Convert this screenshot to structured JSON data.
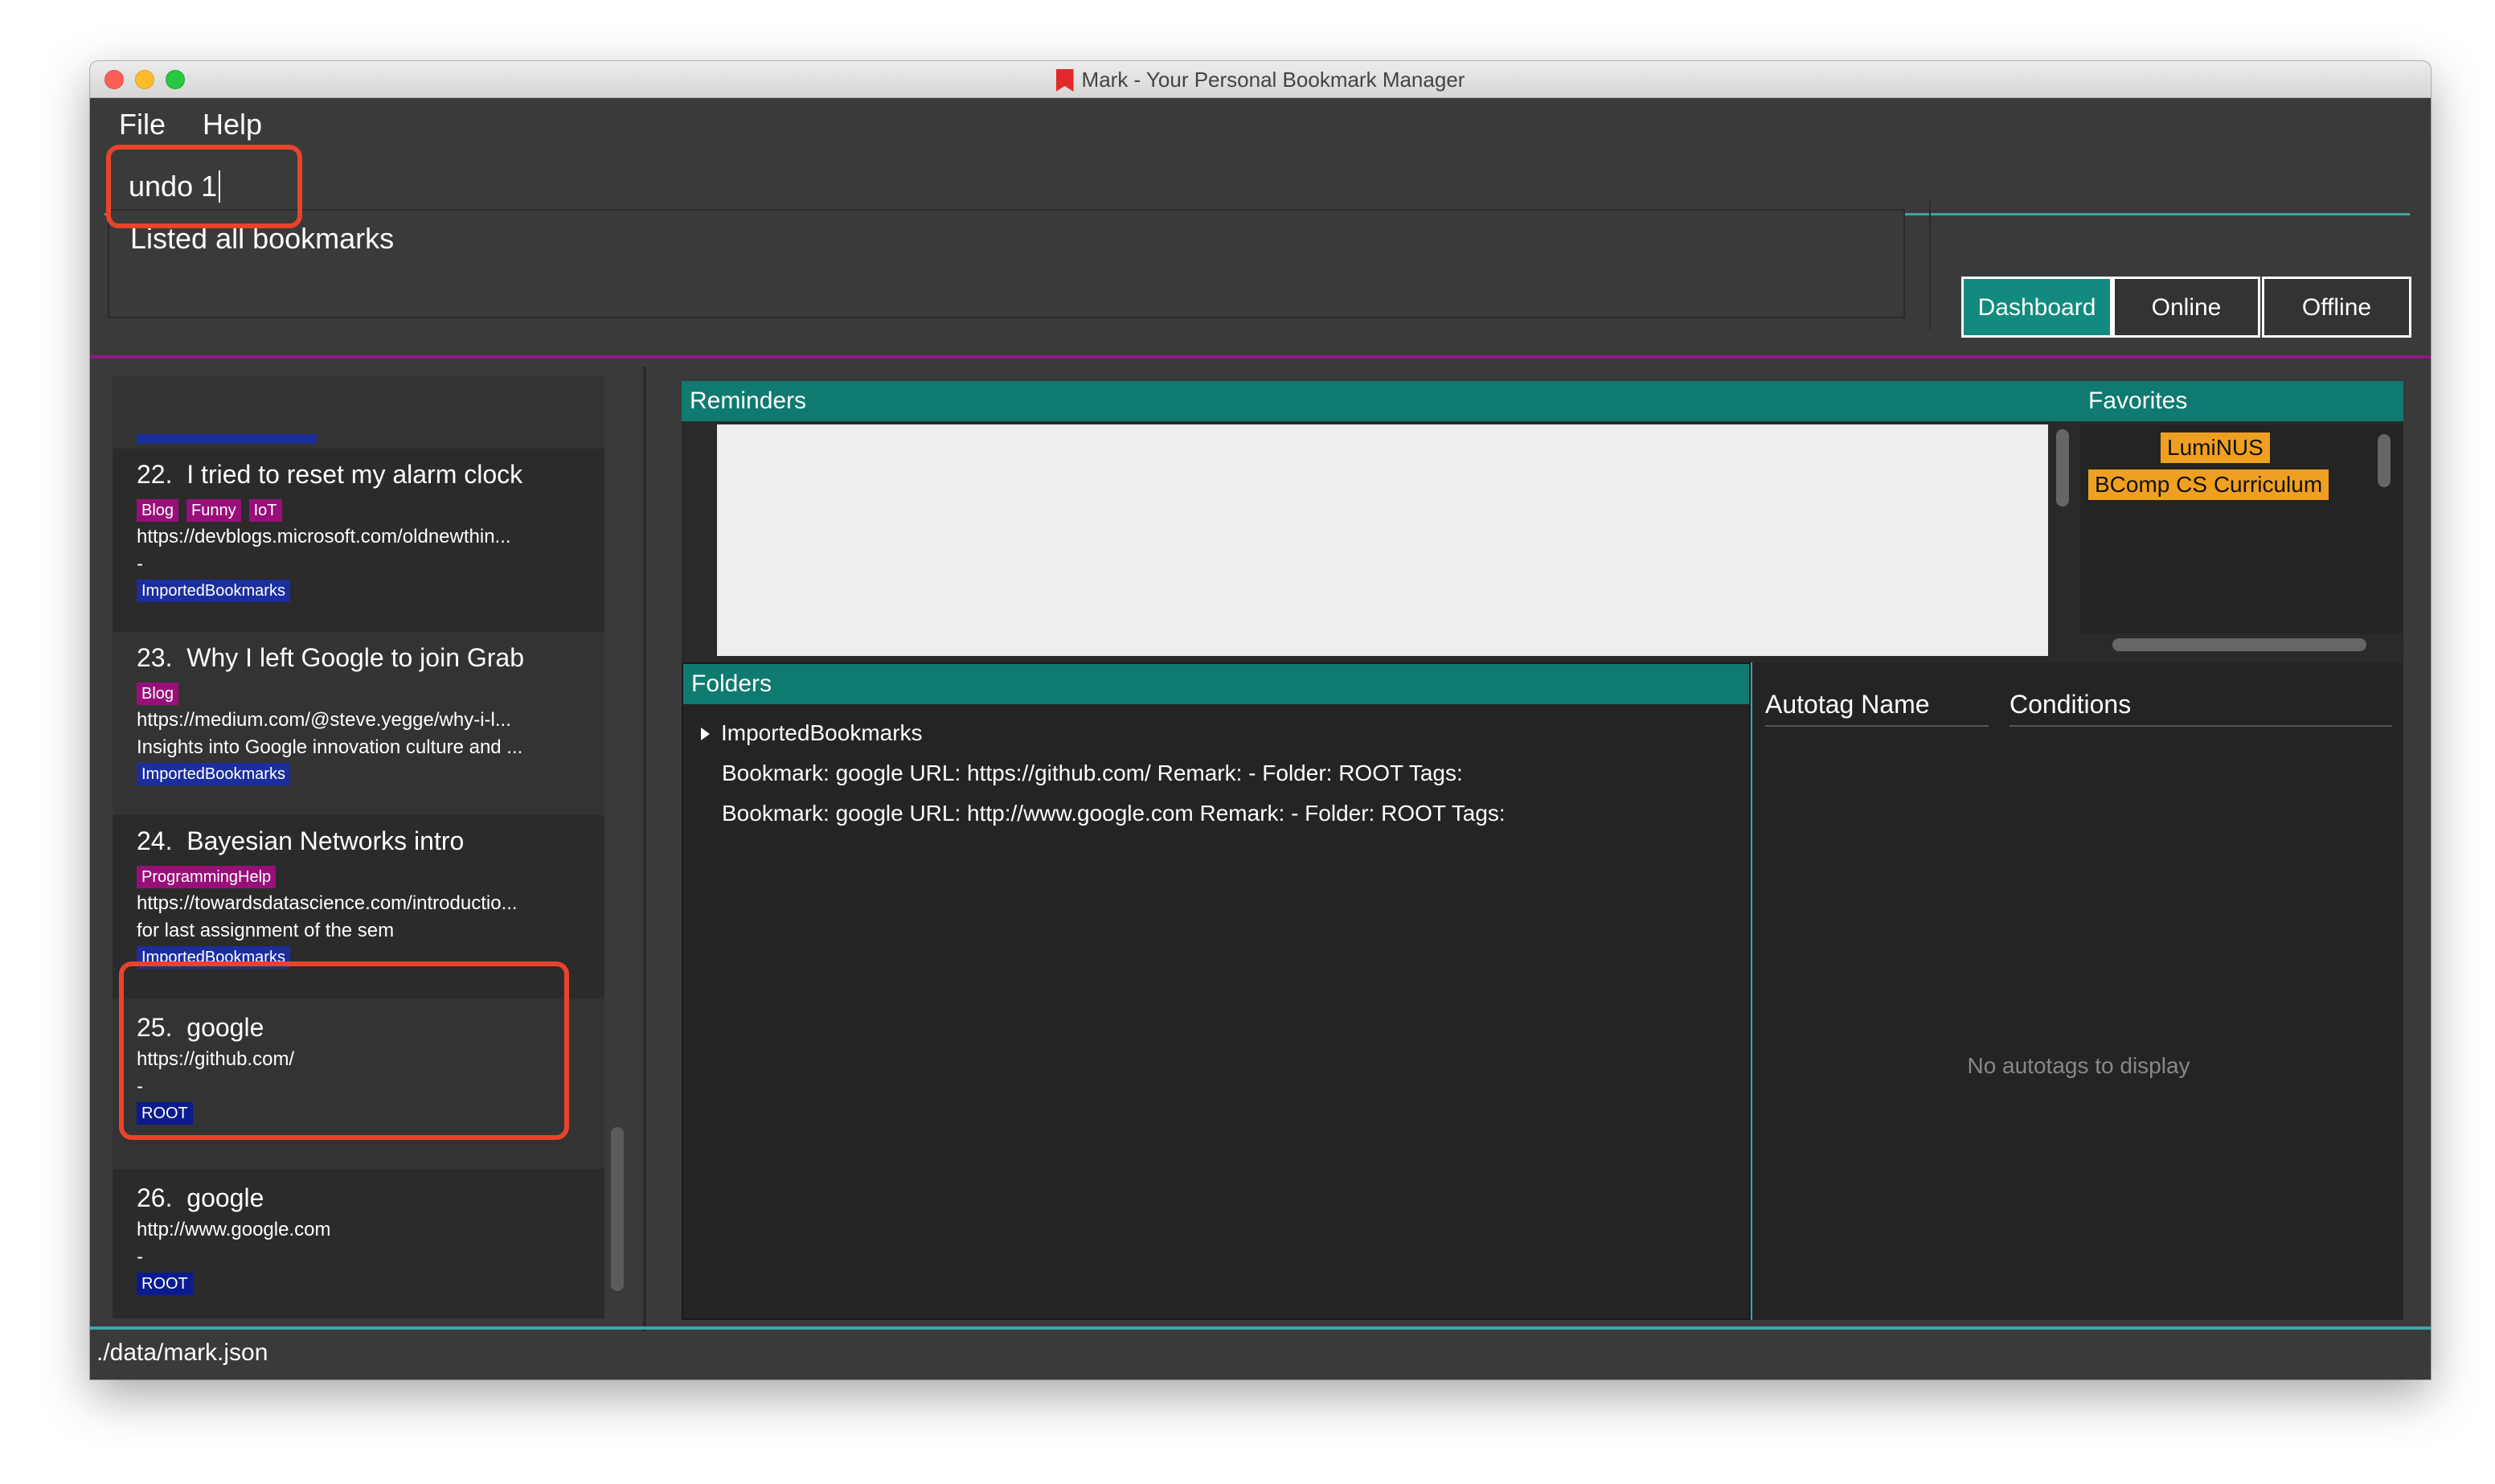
{
  "window": {
    "title": "Mark - Your Personal Bookmark Manager"
  },
  "menu": {
    "file": "File",
    "help": "Help"
  },
  "command": {
    "value": "undo 1"
  },
  "result": {
    "message": "Listed all bookmarks"
  },
  "tabs": {
    "dashboard": "Dashboard",
    "online": "Online",
    "offline": "Offline"
  },
  "bookmarks": [
    {
      "index": "22.",
      "title": "I tried to reset my alarm clock",
      "tags": [
        "Blog",
        "Funny",
        "IoT"
      ],
      "url": "https://devblogs.microsoft.com/oldnewthin...",
      "remark": "-",
      "folder": "ImportedBookmarks"
    },
    {
      "index": "23.",
      "title": "Why I left Google to join Grab",
      "tags": [
        "Blog"
      ],
      "url": "https://medium.com/@steve.yegge/why-i-l...",
      "remark": "Insights into Google innovation culture and ...",
      "folder": "ImportedBookmarks"
    },
    {
      "index": "24.",
      "title": "Bayesian Networks intro",
      "tags": [
        "ProgrammingHelp"
      ],
      "url": "https://towardsdatascience.com/introductio...",
      "remark": "for last assignment of the sem",
      "folder": "ImportedBookmarks"
    },
    {
      "index": "25.",
      "title": "google",
      "tags": [],
      "url": "https://github.com/",
      "remark": "-",
      "folder": "ROOT"
    },
    {
      "index": "26.",
      "title": "google",
      "tags": [],
      "url": "http://www.google.com",
      "remark": "-",
      "folder": "ROOT"
    }
  ],
  "reminders": {
    "header": "Reminders"
  },
  "favorites": {
    "header": "Favorites",
    "items": [
      "LumiNUS",
      "BComp CS Curriculum"
    ]
  },
  "folders": {
    "header": "Folders",
    "tree_root": "ImportedBookmarks",
    "rows": [
      "Bookmark: google URL: https://github.com/ Remark: - Folder: ROOT Tags:",
      "Bookmark: google URL: http://www.google.com Remark: - Folder: ROOT Tags:"
    ]
  },
  "autotags": {
    "col_name": "Autotag Name",
    "col_conditions": "Conditions",
    "empty": "No autotags to display"
  },
  "status": {
    "path": "./data/mark.json"
  },
  "colors": {
    "accent_teal": "#0f7a70",
    "tag_purple": "#990f7a",
    "tag_blue": "#0b1b8f",
    "favorite_orange": "#f0a020",
    "highlight_red": "#e8442c"
  }
}
